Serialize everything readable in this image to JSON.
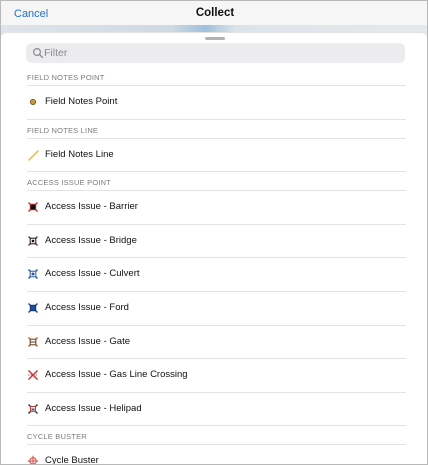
{
  "header": {
    "cancel_label": "Cancel",
    "title": "Collect"
  },
  "search": {
    "placeholder": "Filter"
  },
  "sections": [
    {
      "title": "FIELD NOTES POINT",
      "items": [
        {
          "label": "Field Notes Point",
          "icon": "field-notes-point-icon"
        }
      ]
    },
    {
      "title": "FIELD NOTES LINE",
      "items": [
        {
          "label": "Field Notes Line",
          "icon": "field-notes-line-icon"
        }
      ]
    },
    {
      "title": "ACCESS ISSUE POINT",
      "items": [
        {
          "label": "Access Issue - Barrier",
          "icon": "access-barrier-icon",
          "color": "#d7262b"
        },
        {
          "label": "Access Issue - Bridge",
          "icon": "access-bridge-icon",
          "color": "#222222"
        },
        {
          "label": "Access Issue - Culvert",
          "icon": "access-culvert-icon",
          "color": "#2a56a8"
        },
        {
          "label": "Access Issue - Ford",
          "icon": "access-ford-icon",
          "color": "#1e4fa3"
        },
        {
          "label": "Access Issue - Gate",
          "icon": "access-gate-icon",
          "color": "#b5651d"
        },
        {
          "label": "Access Issue - Gas Line Crossing",
          "icon": "access-gas-line-icon",
          "color": "#d7262b"
        },
        {
          "label": "Access Issue - Helipad",
          "icon": "access-helipad-icon",
          "color": "#333333"
        }
      ]
    },
    {
      "title": "CYCLE BUSTER",
      "items": [
        {
          "label": "Cycle Buster",
          "icon": "cycle-buster-icon",
          "color": "#e0433a"
        }
      ]
    }
  ]
}
